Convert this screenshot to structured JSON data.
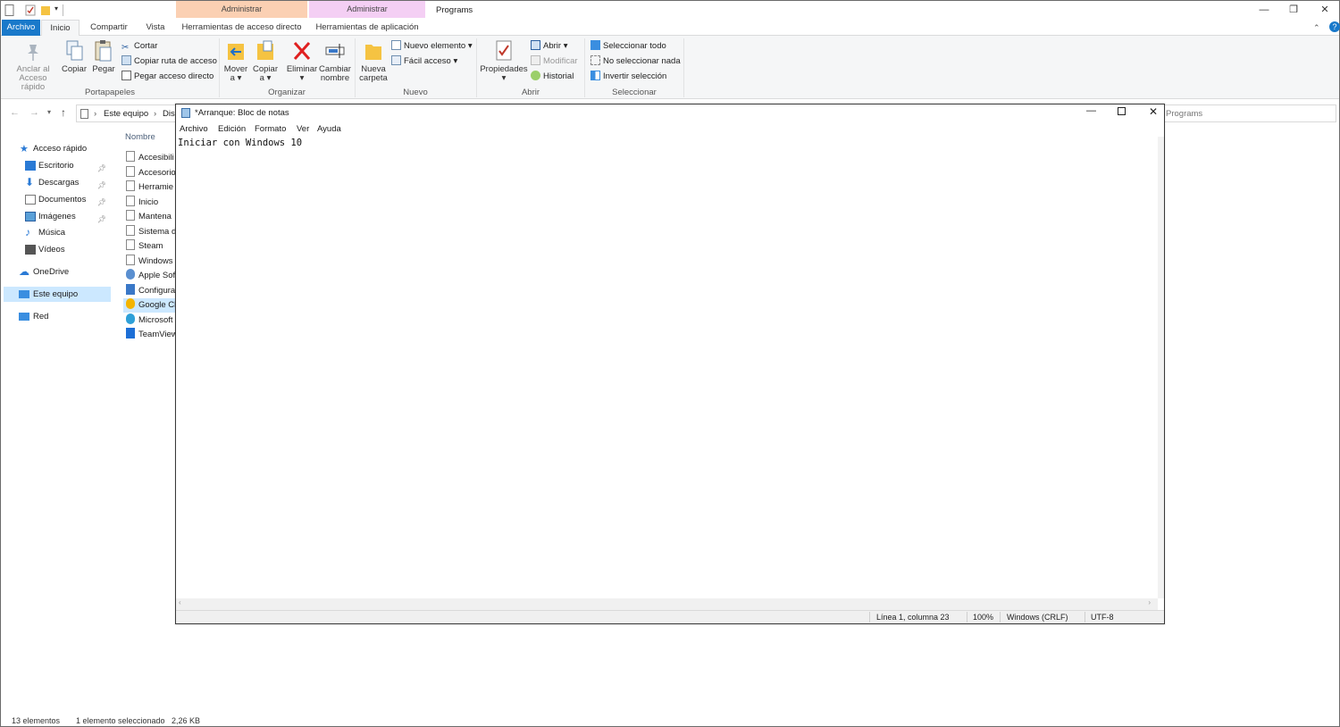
{
  "titlebar": {
    "context_admin_1": "Administrar",
    "context_admin_2": "Administrar",
    "folder_title": "Programs",
    "ctx_color_1": "#fbd0b3",
    "ctx_color_2": "#f4cff4"
  },
  "ribbon_tabs": {
    "archivo": "Archivo",
    "inicio": "Inicio",
    "compartir": "Compartir",
    "vista": "Vista",
    "herramientas_acceso": "Herramientas de acceso directo",
    "herramientas_app": "Herramientas de aplicación",
    "accent": "#1979ca"
  },
  "ribbon": {
    "portapapeles": {
      "label": "Portapapeles",
      "anclar_line1": "Anclar al",
      "anclar_line2": "Acceso rápido",
      "copiar": "Copiar",
      "pegar": "Pegar",
      "cortar": "Cortar",
      "copiar_ruta": "Copiar ruta de acceso",
      "pegar_acceso": "Pegar acceso directo"
    },
    "organizar": {
      "label": "Organizar",
      "mover_line1": "Mover",
      "mover_line2": "a",
      "copiar_line1": "Copiar",
      "copiar_line2": "a",
      "eliminar": "Eliminar",
      "cambiar_line1": "Cambiar",
      "cambiar_line2": "nombre"
    },
    "nuevo": {
      "label": "Nuevo",
      "carpeta_line1": "Nueva",
      "carpeta_line2": "carpeta",
      "nuevo_elemento": "Nuevo elemento",
      "facil_acceso": "Fácil acceso"
    },
    "abrir": {
      "label": "Abrir",
      "propiedades": "Propiedades",
      "abrir": "Abrir",
      "modificar": "Modificar",
      "historial": "Historial"
    },
    "seleccionar": {
      "label": "Seleccionar",
      "todo": "Seleccionar todo",
      "nada": "No seleccionar nada",
      "invertir": "Invertir selección"
    }
  },
  "address": {
    "crumb1": "Este equipo",
    "crumb2": "Disc",
    "search_partial": "Programs"
  },
  "sidebar": {
    "acceso_rapido": "Acceso rápido",
    "escritorio": "Escritorio",
    "descargas": "Descargas",
    "documentos": "Documentos",
    "imagenes": "Imágenes",
    "musica": "Música",
    "videos": "Vídeos",
    "onedrive": "OneDrive",
    "este_equipo": "Este equipo",
    "red": "Red"
  },
  "filelist": {
    "header": "Nombre",
    "items": [
      "Accesibili",
      "Accesorio",
      "Herramie",
      "Inicio",
      "Mantena",
      "Sistema d",
      "Steam",
      "Windows",
      "Apple Sof",
      "Configura",
      "Google Cl",
      "Microsoft",
      "TeamView"
    ]
  },
  "statusbar": {
    "count": "13 elementos",
    "selection": "1 elemento seleccionado",
    "size": "2,26 KB"
  },
  "notepad": {
    "title": "*Arranque: Bloc de notas",
    "menu": [
      "Archivo",
      "Edición",
      "Formato",
      "Ver",
      "Ayuda"
    ],
    "content": "Iniciar con Windows 10",
    "status_position": "Línea 1, columna 23",
    "status_zoom": "100%",
    "status_eol": "Windows (CRLF)",
    "status_encoding": "UTF-8"
  }
}
